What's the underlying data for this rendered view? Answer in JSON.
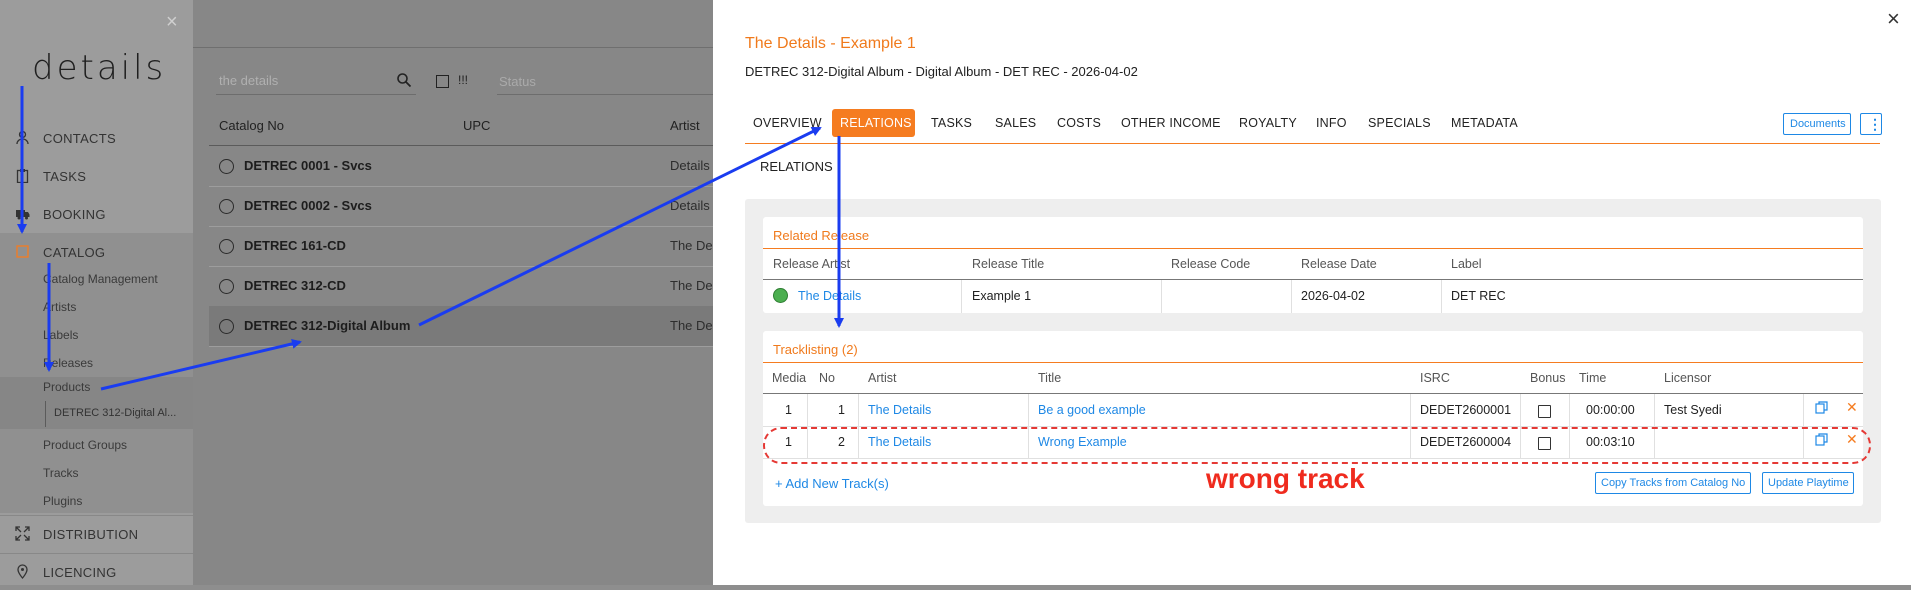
{
  "sidebar": {
    "logo": "details",
    "close_glyph": "×",
    "nav": [
      {
        "label": "CONTACTS",
        "icon": "person-icon"
      },
      {
        "label": "TASKS",
        "icon": "clipboard-icon"
      },
      {
        "label": "BOOKING",
        "icon": "truck-icon"
      },
      {
        "label": "CATALOG",
        "icon": "box-icon"
      },
      {
        "label": "DISTRIBUTION",
        "icon": "expand-icon"
      },
      {
        "label": "LICENCING",
        "icon": "location-icon"
      }
    ],
    "catalog_sub": [
      "Catalog Management",
      "Artists",
      "Labels",
      "Releases",
      "Products",
      "Product Groups",
      "Tracks",
      "Plugins"
    ],
    "product_sub": "DETREC 312-Digital Al..."
  },
  "list": {
    "search_placeholder": "the details",
    "flag_label": "!!!",
    "status_placeholder": "Status",
    "columns": [
      "Catalog No",
      "UPC",
      "Artist"
    ],
    "rows": [
      {
        "catalog_no": "DETREC 0001 - Svcs",
        "artist": "Details"
      },
      {
        "catalog_no": "DETREC 0002 - Svcs",
        "artist": "Details"
      },
      {
        "catalog_no": "DETREC 161-CD",
        "artist": "The De"
      },
      {
        "catalog_no": "DETREC 312-CD",
        "artist": "The De"
      },
      {
        "catalog_no": "DETREC 312-Digital Album",
        "artist": "The De"
      }
    ]
  },
  "drawer": {
    "close_glyph": "×",
    "title": "The Details - Example 1",
    "subtitle": "DETREC 312-Digital Album - Digital Album - DET REC - 2026-04-02",
    "tabs": [
      "OVERVIEW",
      "RELATIONS",
      "TASKS",
      "SALES",
      "COSTS",
      "OTHER INCOME",
      "ROYALTY",
      "INFO",
      "SPECIALS",
      "METADATA"
    ],
    "active_tab": "RELATIONS",
    "documents_label": "Documents",
    "more_glyph": "⋮",
    "section_label": "RELATIONS",
    "related_release": {
      "title": "Related Release",
      "columns": [
        "Release Artist",
        "Release Title",
        "Release Code",
        "Release Date",
        "Label"
      ],
      "row": {
        "artist": "The Details",
        "title": "Example 1",
        "code": "",
        "date": "2026-04-02",
        "label": "DET REC"
      }
    },
    "tracklisting": {
      "title": "Tracklisting (2)",
      "columns": [
        "Media",
        "No",
        "Artist",
        "Title",
        "ISRC",
        "Bonus",
        "Time",
        "Licensor"
      ],
      "rows": [
        {
          "media": "1",
          "no": "1",
          "artist": "The Details",
          "title": "Be a good example",
          "isrc": "DEDET2600001",
          "time": "00:00:00",
          "licensor": "Test Syedi"
        },
        {
          "media": "1",
          "no": "2",
          "artist": "The Details",
          "title": "Wrong Example",
          "isrc": "DEDET2600004",
          "time": "00:03:10",
          "licensor": ""
        }
      ],
      "add_label": "+ Add New Track(s)",
      "copy_label": "Copy Tracks from Catalog No",
      "update_label": "Update Playtime"
    },
    "annotation": "wrong track"
  },
  "colors": {
    "accent": "#f57c20",
    "link": "#1e88e5",
    "annotation": "#ef2b1e",
    "arrow": "#1a3cf0"
  }
}
